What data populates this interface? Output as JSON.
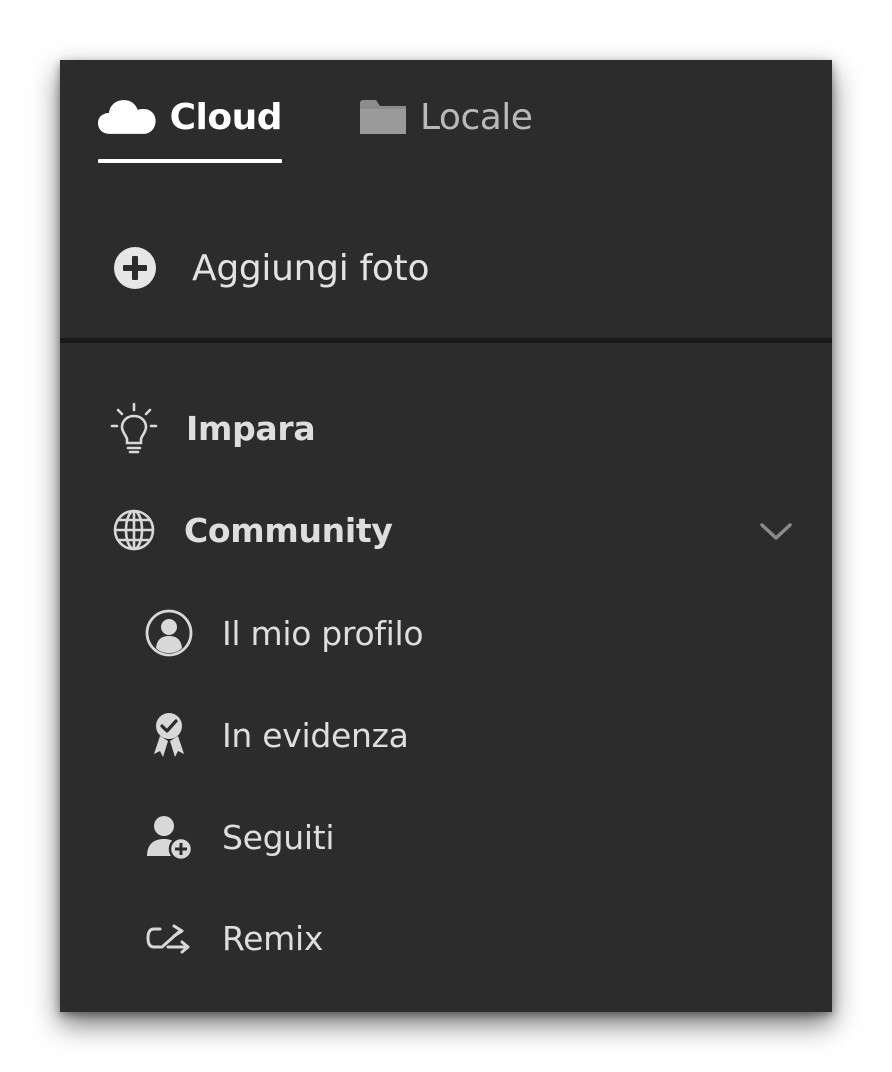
{
  "tabs": [
    {
      "label": "Cloud",
      "icon": "cloud-icon",
      "active": true
    },
    {
      "label": "Locale",
      "icon": "folder-icon",
      "active": false
    }
  ],
  "add_photo": {
    "label": "Aggiungi foto",
    "icon": "plus-circle-icon"
  },
  "nav": {
    "learn": {
      "label": "Impara",
      "icon": "lightbulb-icon"
    },
    "community": {
      "label": "Community",
      "icon": "globe-icon",
      "expanded": true
    },
    "community_items": [
      {
        "label": "Il mio profilo",
        "icon": "user-circle-icon"
      },
      {
        "label": "In evidenza",
        "icon": "award-badge-icon"
      },
      {
        "label": "Seguiti",
        "icon": "user-add-icon"
      },
      {
        "label": "Remix",
        "icon": "remix-icon"
      }
    ]
  },
  "colors": {
    "panel_bg": "#2c2c2c",
    "active_text": "#ffffff",
    "inactive_text": "#b9b9b9",
    "item_text": "#dedede",
    "divider": "#1a1a1a"
  }
}
